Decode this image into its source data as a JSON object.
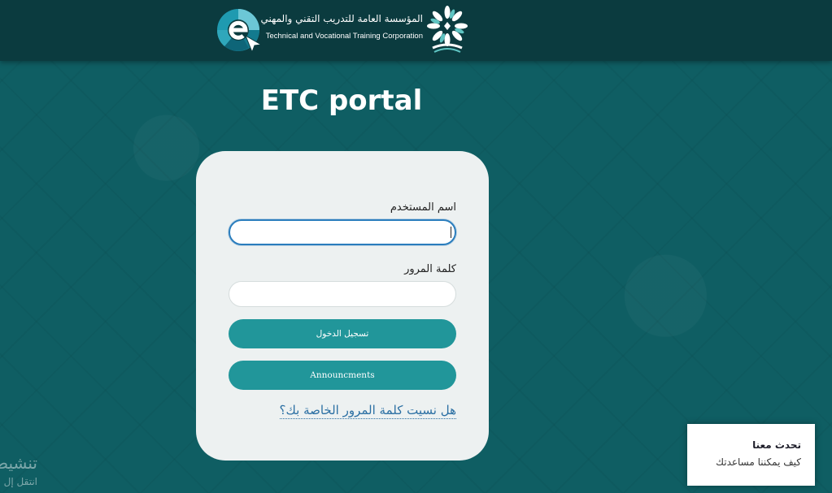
{
  "header": {
    "org_name_ar": "المؤسسة العامة للتدريب التقني والمهني",
    "org_name_en": "Technical and Vocational Training Corporation",
    "logo_icon": "etc-logo-icon",
    "seal_icon": "tvtc-seal-icon"
  },
  "page": {
    "title": "ETC portal"
  },
  "login": {
    "username_label": "اسم المستخدم",
    "username_value": "",
    "password_label": "كلمة المرور",
    "password_value": "",
    "login_button": "تسجيل الدخول",
    "announcements_button": "Announcments",
    "forgot_link": "هل نسيت كلمة المرور الخاصة بك؟"
  },
  "chat": {
    "title": "تحدث معنا",
    "subtitle": "كيف يمكننا مساعدتك"
  },
  "windows_activation": {
    "title": "تنشيط",
    "subtitle": "انتقل إل"
  },
  "colors": {
    "background": "#0f5e63",
    "header": "#0b3b3f",
    "button": "#21969a",
    "card": "#edf1f1",
    "link": "#2b6fa3"
  }
}
